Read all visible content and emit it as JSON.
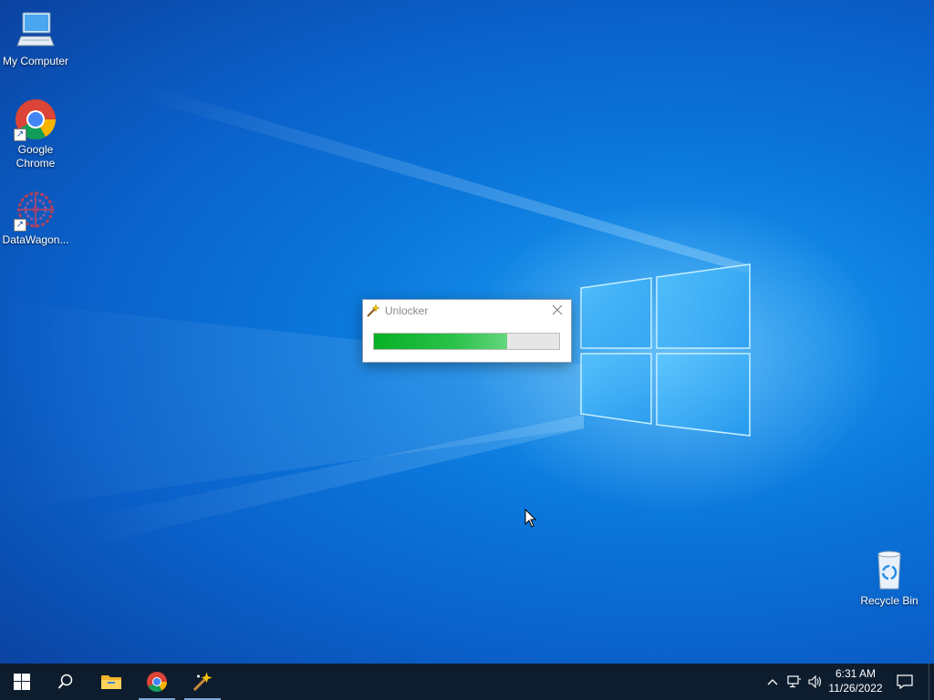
{
  "desktop": {
    "icons": [
      {
        "label": "My Computer",
        "icon": "computer-icon"
      },
      {
        "label": "Google\nChrome",
        "icon": "chrome-icon"
      },
      {
        "label": "DataWagon...",
        "icon": "datawagon-icon"
      }
    ],
    "recycle_bin": {
      "label": "Recycle Bin",
      "icon": "recycle-bin-icon"
    }
  },
  "dialog": {
    "title": "Unlocker",
    "icon": "magic-wand-icon",
    "close_icon": "close-icon",
    "progress": 0.72
  },
  "taskbar": {
    "buttons": [
      {
        "name": "start-button",
        "icon": "windows-logo-icon"
      },
      {
        "name": "search-button",
        "icon": "search-icon"
      },
      {
        "name": "file-explorer-button",
        "icon": "folder-icon"
      },
      {
        "name": "chrome-taskbar-button",
        "icon": "chrome-icon",
        "active": true
      },
      {
        "name": "unlocker-taskbar-button",
        "icon": "magic-wand-icon",
        "active": true
      }
    ],
    "tray": {
      "icons": [
        "chevron-up-icon",
        "network-icon",
        "speaker-icon"
      ],
      "time": "6:31 AM",
      "date": "11/26/2022",
      "notification_icon": "notification-icon"
    }
  },
  "colors": {
    "accent": "#0a78dc",
    "taskbar": "#0e1d2e",
    "progress_fill": "#06b025"
  }
}
